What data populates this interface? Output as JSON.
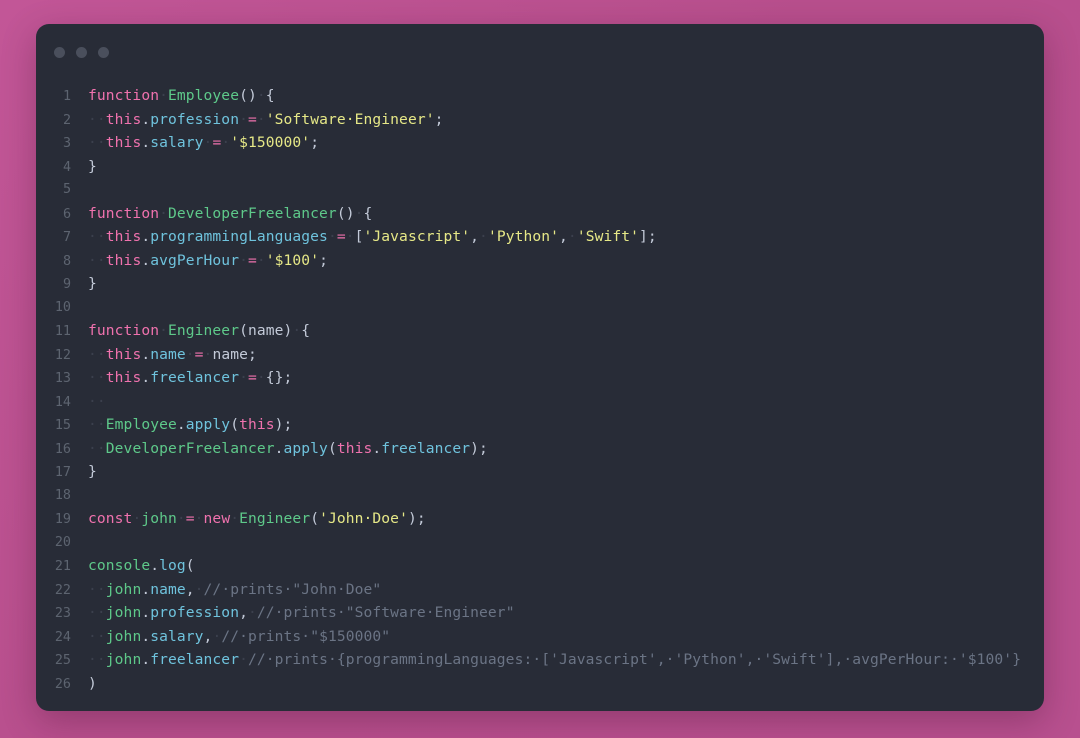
{
  "window": {
    "background_color": "#b8508f",
    "editor_background": "#282c37",
    "traffic_lights": [
      {
        "name": "close-dot",
        "color": "#4a4f5c"
      },
      {
        "name": "minimize-dot",
        "color": "#4a4f5c"
      },
      {
        "name": "maximize-dot",
        "color": "#4a4f5c"
      }
    ]
  },
  "editor": {
    "language": "javascript",
    "line_count": 26,
    "gutter_color": "#5d6470",
    "colors": {
      "keyword": "#f072ae",
      "function_name": "#5ec98a",
      "property": "#6fc3dd",
      "string": "#e6e887",
      "comment": "#6b7485",
      "punctuation": "#c3cad8"
    },
    "lines": [
      {
        "n": "1",
        "text": "function Employee() {"
      },
      {
        "n": "2",
        "text": "  this.profession = 'Software Engineer';"
      },
      {
        "n": "3",
        "text": "  this.salary = '$150000';"
      },
      {
        "n": "4",
        "text": "}"
      },
      {
        "n": "5",
        "text": ""
      },
      {
        "n": "6",
        "text": "function DeveloperFreelancer() {"
      },
      {
        "n": "7",
        "text": "  this.programmingLanguages = ['Javascript', 'Python', 'Swift'];"
      },
      {
        "n": "8",
        "text": "  this.avgPerHour = '$100';"
      },
      {
        "n": "9",
        "text": "}"
      },
      {
        "n": "10",
        "text": ""
      },
      {
        "n": "11",
        "text": "function Engineer(name) {"
      },
      {
        "n": "12",
        "text": "  this.name = name;"
      },
      {
        "n": "13",
        "text": "  this.freelancer = {};"
      },
      {
        "n": "14",
        "text": "  "
      },
      {
        "n": "15",
        "text": "  Employee.apply(this);"
      },
      {
        "n": "16",
        "text": "  DeveloperFreelancer.apply(this.freelancer);"
      },
      {
        "n": "17",
        "text": "}"
      },
      {
        "n": "18",
        "text": ""
      },
      {
        "n": "19",
        "text": "const john = new Engineer('John Doe');"
      },
      {
        "n": "20",
        "text": ""
      },
      {
        "n": "21",
        "text": "console.log("
      },
      {
        "n": "22",
        "text": "  john.name, // prints \"John Doe\""
      },
      {
        "n": "23",
        "text": "  john.profession, // prints \"Software Engineer\""
      },
      {
        "n": "24",
        "text": "  john.salary, // prints \"$150000\""
      },
      {
        "n": "25",
        "text": "  john.freelancer // prints {programmingLanguages: ['Javascript', 'Python', 'Swift'], avgPerHour: '$100'}"
      },
      {
        "n": "26",
        "text": ")"
      }
    ]
  }
}
